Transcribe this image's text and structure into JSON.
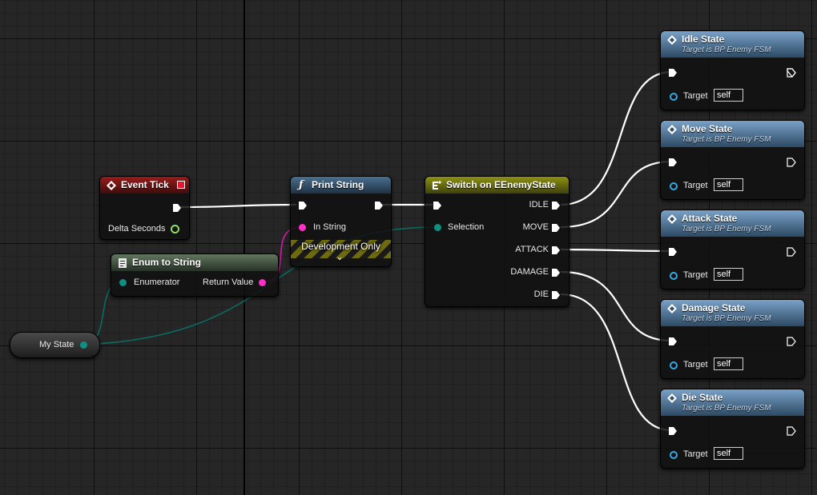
{
  "nodes": {
    "event_tick": {
      "title": "Event Tick",
      "pin_delta": "Delta Seconds"
    },
    "print_string": {
      "title": "Print String",
      "pin_in": "In String",
      "dev_only": "Development Only",
      "expand": "⌄"
    },
    "enum_to_string": {
      "title": "Enum to String",
      "pin_in": "Enumerator",
      "pin_out": "Return Value"
    },
    "my_state": {
      "label": "My State"
    },
    "switch": {
      "title": "Switch on EEnemyState",
      "pin_selection": "Selection",
      "outputs": [
        "IDLE",
        "MOVE",
        "ATTACK",
        "DAMAGE",
        "DIE"
      ]
    },
    "state_calls": [
      {
        "title": "Idle State",
        "subtitle": "Target is BP Enemy FSM",
        "target_label": "Target",
        "target_value": "self"
      },
      {
        "title": "Move State",
        "subtitle": "Target is BP Enemy FSM",
        "target_label": "Target",
        "target_value": "self"
      },
      {
        "title": "Attack State",
        "subtitle": "Target is BP Enemy FSM",
        "target_label": "Target",
        "target_value": "self"
      },
      {
        "title": "Damage State",
        "subtitle": "Target is BP Enemy FSM",
        "target_label": "Target",
        "target_value": "self"
      },
      {
        "title": "Die State",
        "subtitle": "Target is BP Enemy FSM",
        "target_label": "Target",
        "target_value": "self"
      }
    ]
  },
  "colors": {
    "exec_wire": "#ffffff",
    "enum_wire": "#0b6b60",
    "string_wire": "#d61aa8",
    "event_header": "#9a1b1b",
    "function_header": "#4a6f91",
    "switch_header": "#8e9213",
    "call_header": "#79a1c7"
  }
}
